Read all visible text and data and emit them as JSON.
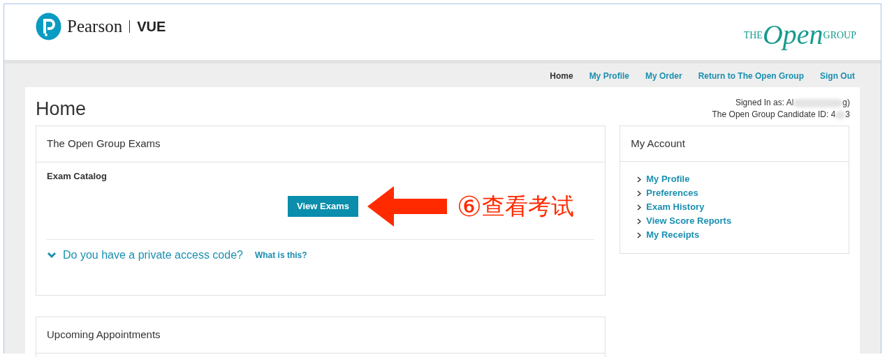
{
  "header": {
    "brand": {
      "name": "Pearson",
      "product": "VUE"
    },
    "partner_logo": {
      "prefix": "THE",
      "main": "Open",
      "suffix": "GROUP"
    }
  },
  "nav": [
    {
      "label": "Home",
      "selected": true
    },
    {
      "label": "My Profile",
      "selected": false
    },
    {
      "label": "My Order",
      "selected": false
    },
    {
      "label": "Return to The Open Group",
      "selected": false
    },
    {
      "label": "Sign Out",
      "selected": false
    }
  ],
  "page_title": "Home",
  "user_info": {
    "signed_in_visible_start": "Signed In as: Al",
    "signed_in_visible_end": "g)",
    "candidate_id_visible_start": "The Open Group Candidate ID: 4",
    "candidate_id_visible_end": "3"
  },
  "exams_panel": {
    "title": "The Open Group Exams",
    "section_label": "Exam Catalog",
    "button": "View Exams",
    "access_code_toggle": "Do you have a private access code?",
    "expanded": false,
    "help_link": "What is this?"
  },
  "annotation": {
    "number": "⑥",
    "text": "查看考试"
  },
  "appointments_panel": {
    "title": "Upcoming Appointments"
  },
  "account_panel": {
    "title": "My Account",
    "links": [
      "My Profile",
      "Preferences",
      "Exam History",
      "View Score Reports",
      "My Receipts"
    ]
  }
}
